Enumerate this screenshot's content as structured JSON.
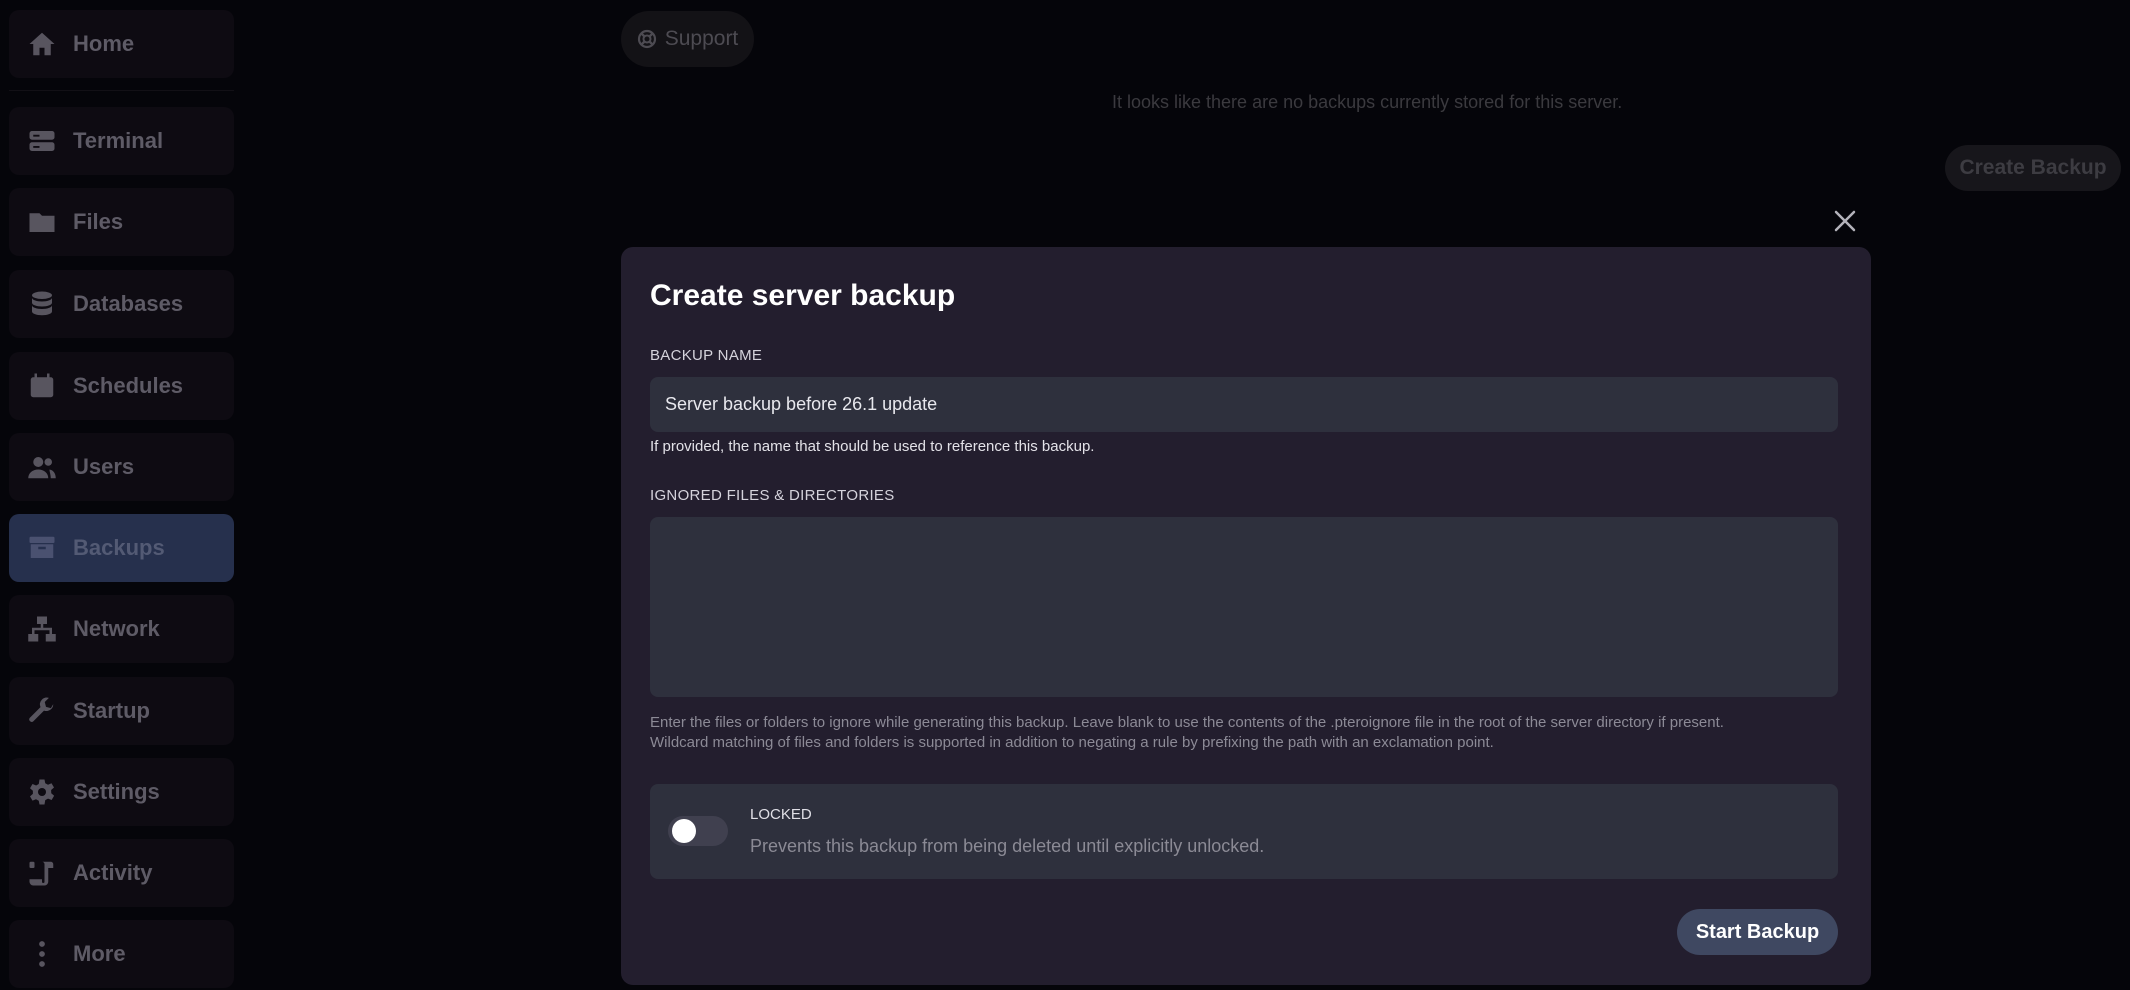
{
  "sidebar": {
    "items": [
      {
        "label": "Home",
        "icon": "home-icon"
      },
      {
        "label": "Terminal",
        "icon": "terminal-icon"
      },
      {
        "label": "Files",
        "icon": "folder-icon"
      },
      {
        "label": "Databases",
        "icon": "database-icon"
      },
      {
        "label": "Schedules",
        "icon": "calendar-icon"
      },
      {
        "label": "Users",
        "icon": "users-icon"
      },
      {
        "label": "Backups",
        "icon": "archive-icon",
        "active": true
      },
      {
        "label": "Network",
        "icon": "network-icon"
      },
      {
        "label": "Startup",
        "icon": "wrench-icon"
      },
      {
        "label": "Settings",
        "icon": "gear-icon"
      },
      {
        "label": "Activity",
        "icon": "scroll-icon"
      },
      {
        "label": "More",
        "icon": "more-vertical-icon"
      }
    ]
  },
  "background": {
    "support_label": "Support",
    "empty_message": "It looks like there are no backups currently stored for this server.",
    "create_backup_label": "Create Backup"
  },
  "modal": {
    "title": "Create server backup",
    "backup_name": {
      "label": "BACKUP NAME",
      "value": "Server backup before 26.1 update",
      "helper": "If provided, the name that should be used to reference this backup."
    },
    "ignored": {
      "label": "IGNORED FILES & DIRECTORIES",
      "value": "",
      "hint_line1": "Enter the files or folders to ignore while generating this backup. Leave blank to use the contents of the .pteroignore file in the root of the server directory if present.",
      "hint_line2": "Wildcard matching of files and folders is supported in addition to negating a rule by prefixing the path with an exclamation point."
    },
    "locked": {
      "title": "LOCKED",
      "description": "Prevents this backup from being deleted until explicitly unlocked.",
      "enabled": false
    },
    "start_label": "Start Backup"
  },
  "colors": {
    "background": "#05050a",
    "sidebar_item": "#0e0b12",
    "sidebar_active": "#26304d",
    "modal": "#231e2e",
    "input": "#2e303d",
    "primary_button": "#3f4861"
  }
}
